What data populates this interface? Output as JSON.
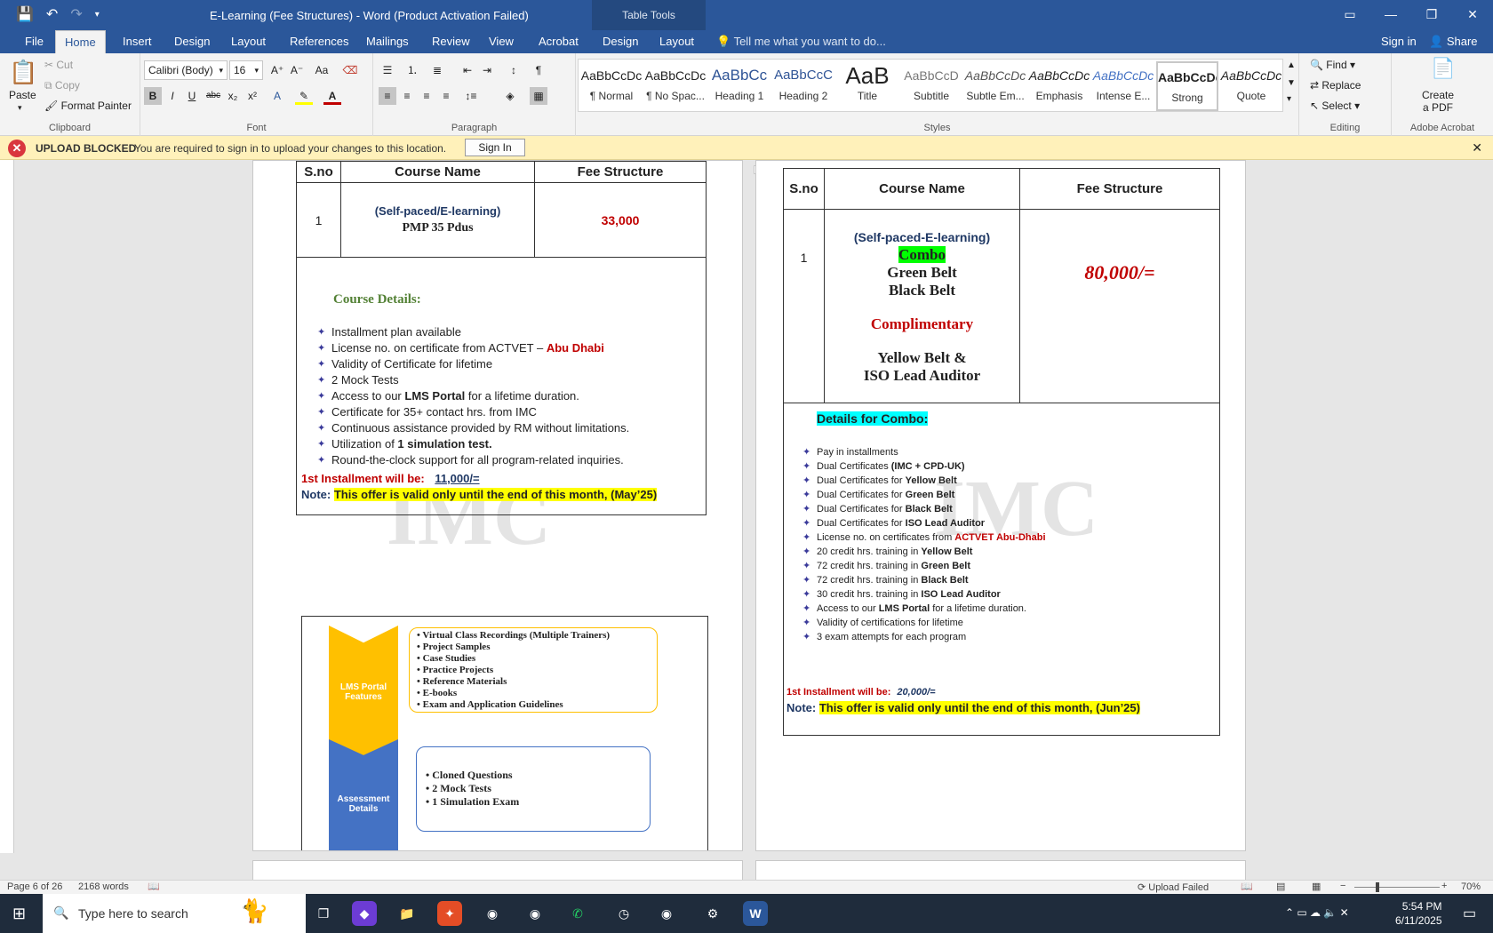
{
  "window": {
    "title": "E-Learning (Fee Structures) - Word (Product Activation Failed)",
    "context_tab_group": "Table Tools",
    "controls": [
      "ribbon-options",
      "minimize",
      "maximize",
      "close"
    ]
  },
  "tabs": [
    {
      "label": "File"
    },
    {
      "label": "Home"
    },
    {
      "label": "Insert"
    },
    {
      "label": "Design"
    },
    {
      "label": "Layout"
    },
    {
      "label": "References"
    },
    {
      "label": "Mailings"
    },
    {
      "label": "Review"
    },
    {
      "label": "View"
    },
    {
      "label": "Acrobat"
    },
    {
      "label": "Design"
    },
    {
      "label": "Layout"
    }
  ],
  "tell_me": "Tell me what you want to do...",
  "sign_in": "Sign in",
  "share": "Share",
  "clipboard": {
    "paste": "Paste",
    "cut": "Cut",
    "copy": "Copy",
    "format_painter": "Format Painter",
    "label": "Clipboard"
  },
  "font": {
    "name": "Calibri (Body)",
    "size": "16",
    "label": "Font"
  },
  "paragraph": {
    "label": "Paragraph"
  },
  "styles": {
    "label": "Styles",
    "items": [
      {
        "preview": "AaBbCcDc",
        "name": "¶ Normal"
      },
      {
        "preview": "AaBbCcDc",
        "name": "¶ No Spac..."
      },
      {
        "preview": "AaBbCc",
        "name": "Heading 1"
      },
      {
        "preview": "AaBbCcC",
        "name": "Heading 2"
      },
      {
        "preview": "AaB",
        "name": "Title"
      },
      {
        "preview": "AaBbCcD",
        "name": "Subtitle"
      },
      {
        "preview": "AaBbCcDc",
        "name": "Subtle Em..."
      },
      {
        "preview": "AaBbCcDc",
        "name": "Emphasis"
      },
      {
        "preview": "AaBbCcDc",
        "name": "Intense E..."
      },
      {
        "preview": "AaBbCcDc",
        "name": "Strong"
      },
      {
        "preview": "AaBbCcDc",
        "name": "Quote"
      }
    ]
  },
  "editing": {
    "find": "Find",
    "replace": "Replace",
    "select": "Select",
    "label": "Editing"
  },
  "acrobat": {
    "create_pdf_1": "Create",
    "create_pdf_2": "a PDF",
    "label": "Adobe Acrobat"
  },
  "infobar": {
    "title": "UPLOAD BLOCKED",
    "message": "You are required to sign in to upload your changes to this location.",
    "button": "Sign In"
  },
  "page1": {
    "headers": [
      "S.no",
      "Course Name",
      "Fee Structure"
    ],
    "row_no": "1",
    "course_line1": "(Self-paced/E-learning)",
    "course_line2": "PMP 35 Pdus",
    "fee": "33,000",
    "details_title": "Course Details:",
    "details": [
      "Installment plan available",
      "License no. on certificate from ACTVET – ",
      "Validity of Certificate for lifetime",
      " 2 Mock Tests",
      "Access to our ",
      "Certificate for 35+ contact hrs. from IMC",
      "Continuous assistance provided by RM without limitations.",
      "Utilization of ",
      "Round-the-clock support for all program-related inquiries."
    ],
    "abu_dhabi": "Abu Dhabi",
    "lms_portal": "LMS Portal",
    "lms_tail": " for a lifetime duration.",
    "one_sim": "1 simulation test.",
    "installment_label": "1st Installment will be:",
    "installment_value": "11,000/=",
    "note_label": "Note:",
    "note_text": "This offer is valid only until the end of this month, (May’25)",
    "lms_features_title": "LMS Portal Features",
    "lms_features": [
      "Virtual Class Recordings (Multiple Trainers)",
      "Project Samples",
      "Case Studies",
      "Practice Projects",
      "Reference Materials",
      "E-books",
      "Exam and Application Guidelines"
    ],
    "assessment_title": "Assessment Details",
    "assessment": [
      "Cloned Questions",
      "2 Mock Tests",
      "1  Simulation Exam"
    ]
  },
  "page2": {
    "headers": [
      "S.no",
      "Course Name",
      "Fee Structure"
    ],
    "row_no": "1",
    "course_line1": "(Self-paced-E-learning)",
    "combo": "Combo",
    "green": "Green Belt",
    "black": "Black Belt",
    "complimentary": "Complimentary",
    "yellow": "Yellow Belt &",
    "iso": "ISO Lead Auditor",
    "fee": "80,000/=",
    "details_title": "Details for Combo:",
    "details": [
      {
        "pre": "Pay in installments",
        "bold": "",
        "red": ""
      },
      {
        "pre": "Dual Certificates ",
        "bold": "(IMC + CPD-UK)",
        "red": ""
      },
      {
        "pre": "Dual Certificates for ",
        "bold": "Yellow Belt",
        "red": ""
      },
      {
        "pre": "Dual Certificates for ",
        "bold": "Green Belt",
        "red": ""
      },
      {
        "pre": "Dual Certificates for ",
        "bold": "Black Belt",
        "red": ""
      },
      {
        "pre": "Dual Certificates for ",
        "bold": "ISO Lead Auditor",
        "red": ""
      },
      {
        "pre": "License no. on certificates from ",
        "bold": "",
        "red": "ACTVET Abu-Dhabi"
      },
      {
        "pre": "20 credit hrs. training in ",
        "bold": "Yellow Belt",
        "red": ""
      },
      {
        "pre": "72 credit hrs. training in ",
        "bold": "Green Belt",
        "red": ""
      },
      {
        "pre": "72 credit hrs. training in ",
        "bold": "Black Belt",
        "red": ""
      },
      {
        "pre": "30 credit hrs. training in ",
        "bold": "ISO Lead Auditor",
        "red": ""
      },
      {
        "pre": "Access to our ",
        "bold": "LMS Portal",
        "red": "",
        "post": " for a lifetime duration."
      },
      {
        "pre": "Validity of certifications for lifetime",
        "bold": "",
        "red": ""
      },
      {
        "pre": "3 exam attempts for each program",
        "bold": "",
        "red": ""
      }
    ],
    "installment_label": "1st Installment will be:",
    "installment_value": "20,000/=",
    "note_label": "Note:",
    "note_text": "This offer is valid only until the end of this month, (Jun’25)"
  },
  "watermark": "IMC",
  "status": {
    "page": "Page 6 of 26",
    "words": "2168 words",
    "upload": "Upload Failed",
    "zoom": "70%"
  },
  "taskbar": {
    "search_placeholder": "Type here to search",
    "time": "5:54 PM",
    "date": "6/11/2025"
  }
}
